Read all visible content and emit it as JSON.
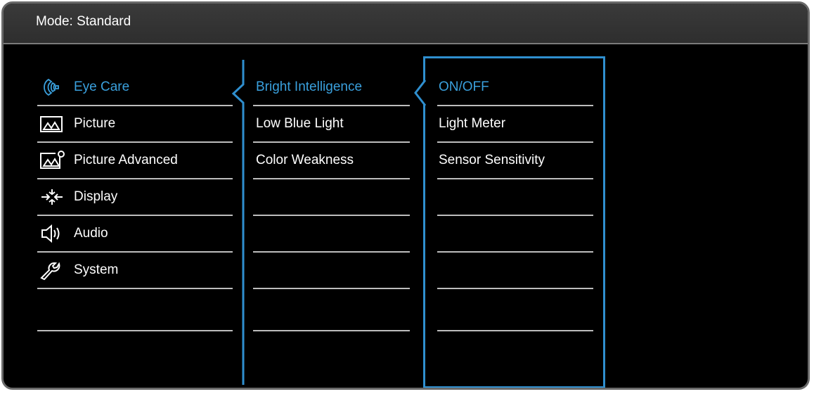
{
  "header": {
    "title": "Mode: Standard"
  },
  "colors": {
    "accent": "#3aa0dd",
    "text": "#ffffff",
    "line": "#bdbdbd",
    "background": "#000000"
  },
  "main_menu": [
    {
      "label": "Eye Care",
      "icon": "eye-care-icon",
      "active": true
    },
    {
      "label": "Picture",
      "icon": "picture-icon",
      "active": false
    },
    {
      "label": "Picture Advanced",
      "icon": "picture-advanced-icon",
      "active": false
    },
    {
      "label": "Display",
      "icon": "display-icon",
      "active": false
    },
    {
      "label": "Audio",
      "icon": "audio-icon",
      "active": false
    },
    {
      "label": "System",
      "icon": "system-wrench-icon",
      "active": false
    },
    {
      "label": "",
      "icon": "",
      "active": false
    }
  ],
  "sub_menu": [
    {
      "label": "Bright Intelligence",
      "active": true
    },
    {
      "label": "Low Blue Light",
      "active": false
    },
    {
      "label": "Color Weakness",
      "active": false
    },
    {
      "label": "",
      "active": false
    },
    {
      "label": "",
      "active": false
    },
    {
      "label": "",
      "active": false
    },
    {
      "label": "",
      "active": false
    }
  ],
  "option_menu": [
    {
      "label": "ON/OFF",
      "active": true
    },
    {
      "label": "Light Meter",
      "active": false
    },
    {
      "label": "Sensor Sensitivity",
      "active": false
    },
    {
      "label": "",
      "active": false
    },
    {
      "label": "",
      "active": false
    },
    {
      "label": "",
      "active": false
    },
    {
      "label": "",
      "active": false
    }
  ]
}
